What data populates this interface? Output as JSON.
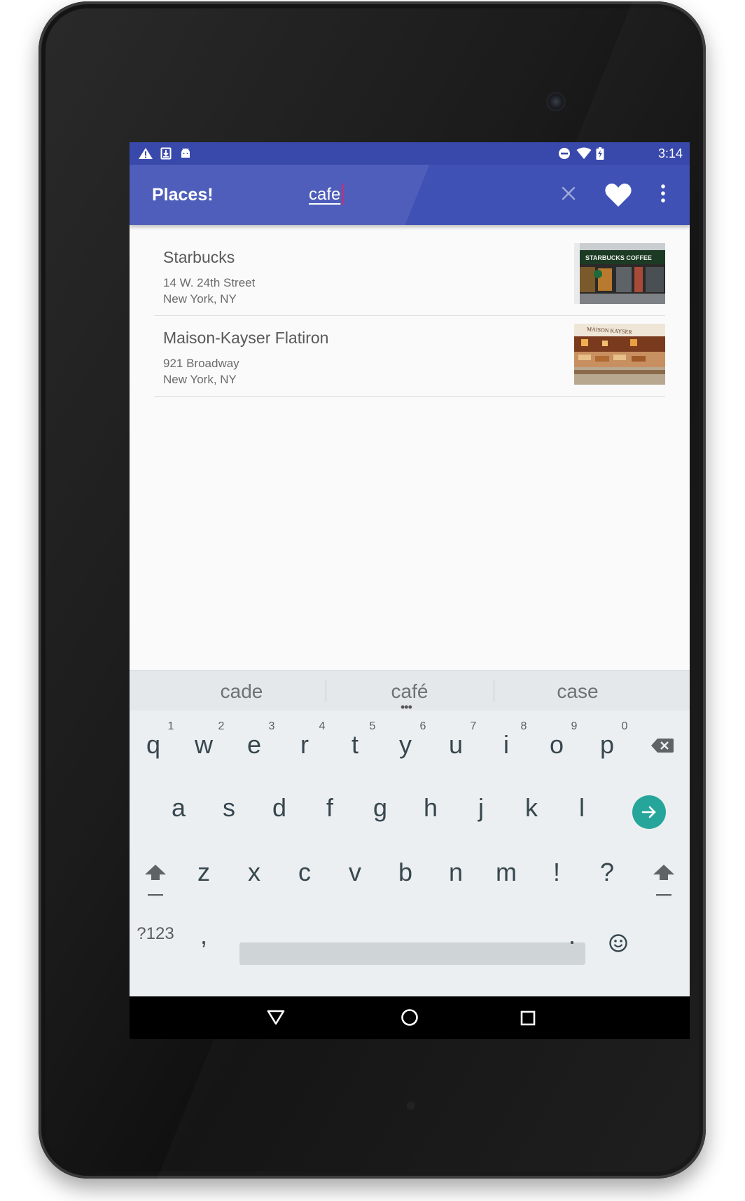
{
  "status_bar": {
    "time": "3:14",
    "left_icons": [
      "warning-icon",
      "download-icon",
      "android-icon"
    ],
    "right_icons": [
      "do-not-disturb-icon",
      "wifi-icon",
      "battery-charging-icon"
    ]
  },
  "app_bar": {
    "title": "Places!",
    "search_value": "cafe",
    "actions": [
      "clear-icon",
      "favorite-heart-icon",
      "more-vert-icon"
    ],
    "color": "#3f51b5",
    "status_color": "#3949ab"
  },
  "results": [
    {
      "name": "Starbucks",
      "address_line1": "14 W. 24th Street",
      "address_line2": "New York, NY",
      "image_sign_text": "STARBUCKS COFFEE"
    },
    {
      "name": "Maison-Kayser Flatiron",
      "address_line1": "921 Broadway",
      "address_line2": "New York, NY",
      "image_sign_text": "MAISON KAYSER"
    }
  ],
  "keyboard": {
    "suggestions": [
      "cade",
      "café",
      "case"
    ],
    "number_hints": [
      "1",
      "2",
      "3",
      "4",
      "5",
      "6",
      "7",
      "8",
      "9",
      "0"
    ],
    "row1": [
      "q",
      "w",
      "e",
      "r",
      "t",
      "y",
      "u",
      "i",
      "o",
      "p"
    ],
    "row2": [
      "a",
      "s",
      "d",
      "f",
      "g",
      "h",
      "j",
      "k",
      "l"
    ],
    "row3": [
      "z",
      "x",
      "c",
      "v",
      "b",
      "n",
      "m",
      "!",
      "?"
    ],
    "symbols_key": "?123",
    "comma_key": ",",
    "period_key": ".",
    "accent_color": "#26a69a"
  },
  "nav_bar": {
    "buttons": [
      "back-icon",
      "home-icon",
      "recents-icon"
    ]
  }
}
